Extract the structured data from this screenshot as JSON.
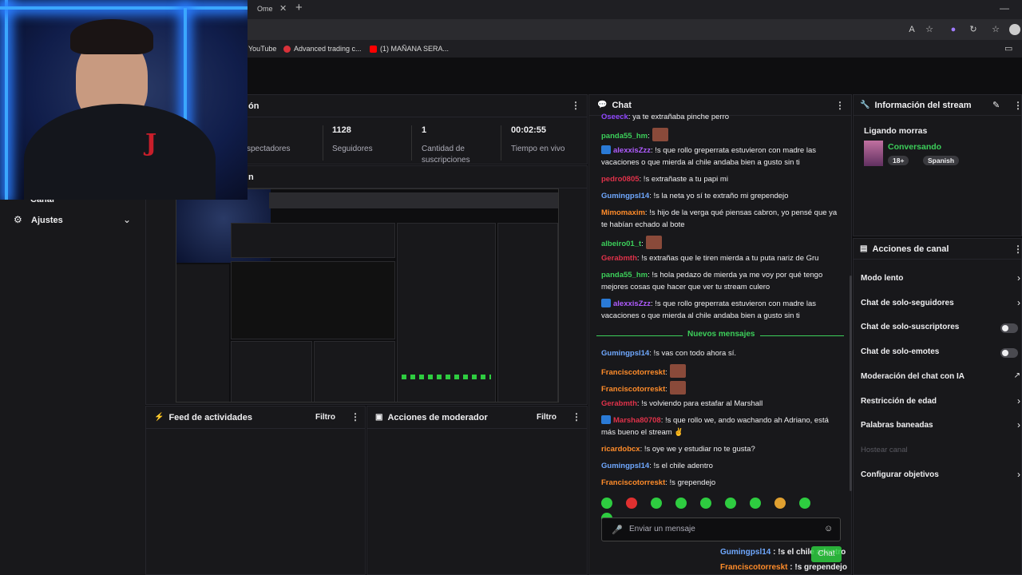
{
  "browser": {
    "tab_title": "Ome",
    "bookmarks": [
      "YouTube",
      "Advanced trading c...",
      "(1) MAÑANA SERA..."
    ]
  },
  "stats": {
    "title_fragment": "ón",
    "viewers_label": "spectadores",
    "followers": "1128",
    "followers_label": "Seguidores",
    "subs": "1",
    "subs_label": "Cantidad de suscripciones",
    "uptime": "00:02:55",
    "uptime_label": "Tiempo en vivo"
  },
  "preview_fragment": "n",
  "sidebar": {
    "partial_item": "Canal",
    "settings": "Ajustes"
  },
  "feed": {
    "title": "Feed de actividades",
    "filter": "Filtro"
  },
  "mod_actions": {
    "title": "Acciones de moderador",
    "filter": "Filtro"
  },
  "chat": {
    "title": "Chat",
    "messages": [
      {
        "user": "Oseeck",
        "color": "#9147ff",
        "text": ": ya te extrañaba pinche perro",
        "badge": false
      },
      {
        "user": "panda55_hm",
        "color": "#3ccf5a",
        "text": ":",
        "badge": false,
        "emote": true
      },
      {
        "user": "alexxisZzz",
        "color": "#b05cff",
        "text": ": !s que rollo greperrata estuvieron con madre las vacaciones o que mierda al chile andaba bien a gusto sin ti",
        "badge": true
      },
      {
        "user": "pedro0805",
        "color": "#e0324a",
        "text": ": !s extrañaste a tu papi mi",
        "badge": false
      },
      {
        "user": "Gumingpsl14",
        "color": "#6fa8ff",
        "text": ": !s la neta yo sí te extraño mi grependejo",
        "badge": false
      },
      {
        "user": "Mimomaxim",
        "color": "#ff8c2a",
        "text": ": !s hijo de la verga qué piensas cabron, yo pensé que ya te habían echado al bote",
        "badge": false
      },
      {
        "user": "albeiro01_t",
        "color": "#3ccf5a",
        "text": ":",
        "badge": false,
        "emote": true
      },
      {
        "user": "Gerabmth",
        "color": "#e0324a",
        "text": ": !s extrañas que le tiren mierda a tu puta nariz de Gru",
        "badge": false
      },
      {
        "user": "panda55_hm",
        "color": "#3ccf5a",
        "text": ": !s hola pedazo de mierda ya me voy por qué tengo mejores cosas que hacer que ver tu stream culero",
        "badge": false
      },
      {
        "user": "alexxisZzz",
        "color": "#b05cff",
        "text": ": !s que rollo greperrata estuvieron con madre las vacaciones o que mierda al chile andaba bien a gusto sin ti",
        "badge": true
      }
    ],
    "new_messages": "Nuevos mensajes",
    "new_list": [
      {
        "user": "Gumingpsl14",
        "color": "#6fa8ff",
        "text": ": !s vas con todo ahora sí.",
        "badge": false
      },
      {
        "user": "Franciscotorreskt",
        "color": "#ff8c2a",
        "text": ":",
        "badge": false,
        "emote": true
      },
      {
        "user": "Franciscotorreskt",
        "color": "#ff8c2a",
        "text": ":",
        "badge": false,
        "emote": true
      },
      {
        "user": "Gerabmth",
        "color": "#e0324a",
        "text": ": !s volviendo para estafar al Marshall",
        "badge": false
      },
      {
        "user": "Marsha80708",
        "color": "#e0324a",
        "text": ": !s que rollo we, ando wachando ah Adriano, está más bueno el stream ✌",
        "badge": true
      },
      {
        "user": "ricardobcx",
        "color": "#ff8c2a",
        "text": ": !s oye we y estudiar no te gusta?",
        "badge": false
      },
      {
        "user": "Gumingpsl14",
        "color": "#6fa8ff",
        "text": ": !s el chile adentro",
        "badge": false
      },
      {
        "user": "Franciscotorreskt",
        "color": "#ff8c2a",
        "text": ": !s grependejo",
        "badge": false
      }
    ],
    "input_placeholder": "Enviar un mensaje",
    "send_label": "Chat",
    "overlay_1_user": "Gumingpsl14",
    "overlay_1_text": " : !s el chile adentro",
    "overlay_2_user": "Franciscotorreskt",
    "overlay_2_text": " : !s grependejo"
  },
  "stream_info": {
    "title": "Información del stream",
    "stream_title": "Ligando morras",
    "category": "Conversando",
    "rating": "18+",
    "language": "Spanish"
  },
  "channel_actions": {
    "title": "Acciones de canal",
    "items": [
      {
        "label": "Modo lento",
        "control": "chevron"
      },
      {
        "label": "Chat de solo-seguidores",
        "control": "chevron"
      },
      {
        "label": "Chat de solo-suscriptores",
        "control": "toggle"
      },
      {
        "label": "Chat de solo-emotes",
        "control": "toggle"
      },
      {
        "label": "Moderación del chat con IA",
        "control": "external"
      },
      {
        "label": "Restricción de edad",
        "control": "chevron"
      },
      {
        "label": "Palabras baneadas",
        "control": "chevron"
      },
      {
        "label": "Hostear canal",
        "control": "none"
      },
      {
        "label": "Configurar objetivos",
        "control": "chevron"
      }
    ]
  },
  "colors": {
    "accent": "#9147ff",
    "new_line": "#3ccf5a",
    "panel": "#18181b",
    "bg": "#0e0e10"
  }
}
